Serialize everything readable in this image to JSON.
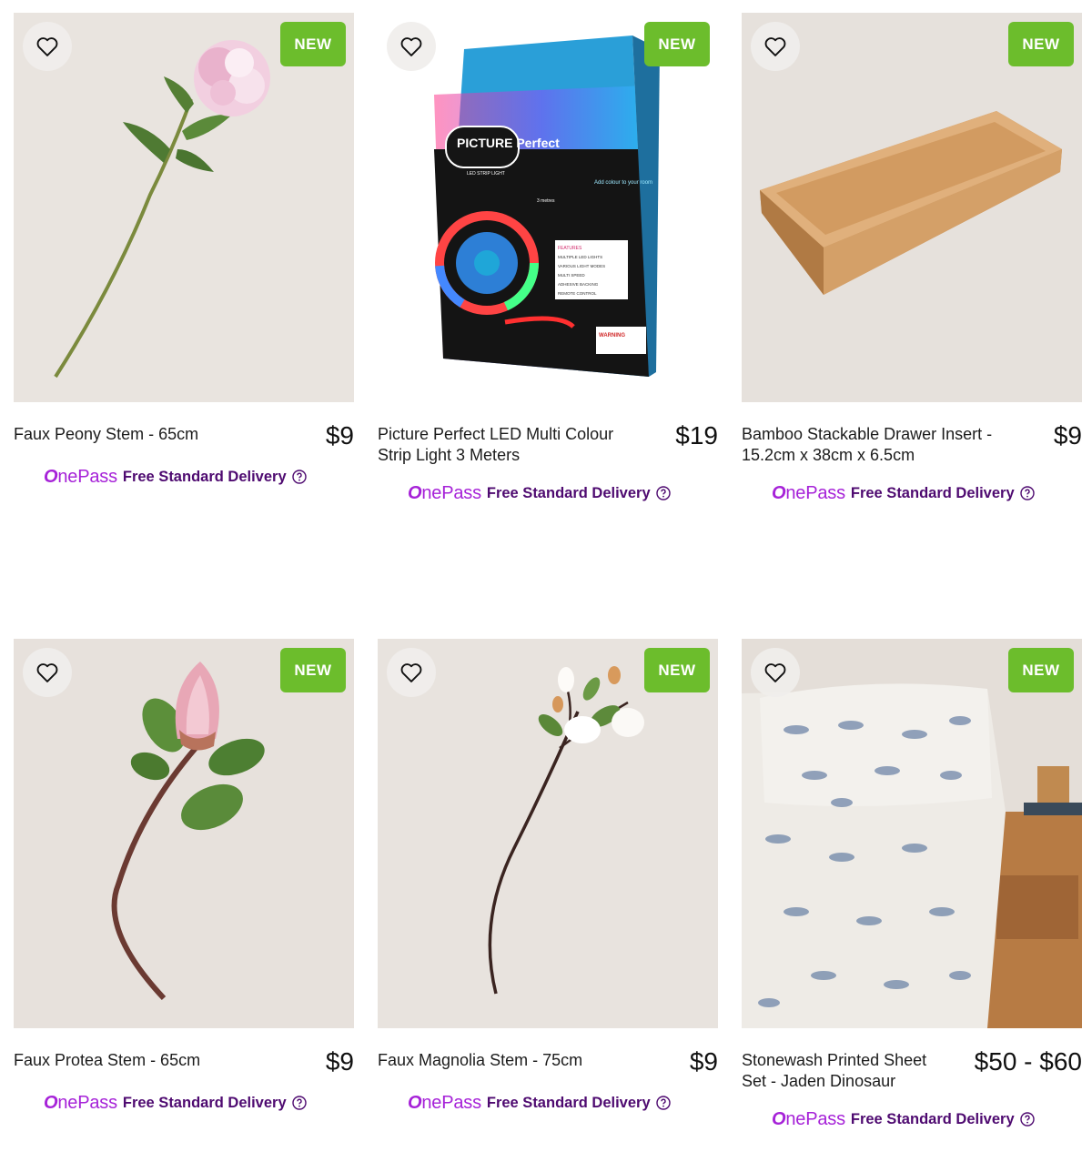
{
  "products": [
    {
      "name": "Faux Peony Stem - 65cm",
      "price": "$9",
      "badge": "NEW",
      "image": "faux-peony-image"
    },
    {
      "name": "Picture Perfect LED Multi Colour Strip Light 3 Meters",
      "price": "$19",
      "badge": "NEW",
      "image": "led-strip-box-image",
      "box_text": {
        "brand": "PICTURE Perfect",
        "product": "LED STRIP LIGHT",
        "length": "3 metres",
        "tagline": "Add colour to your room",
        "warning": "WARNING",
        "features_title": "FEATURES",
        "features": [
          "MULTIPLE LED LIGHTS",
          "VARIOUS LIGHT MODES",
          "MULTI SPEED",
          "ADHESIVE BACKING",
          "REMOTE CONTROL"
        ]
      }
    },
    {
      "name": "Bamboo Stackable Drawer Insert - 15.2cm x 38cm x 6.5cm",
      "price": "$9",
      "badge": "NEW",
      "image": "bamboo-tray-image"
    },
    {
      "name": "Faux Protea Stem - 65cm",
      "price": "$9",
      "badge": "NEW",
      "image": "faux-protea-image"
    },
    {
      "name": "Faux Magnolia Stem - 75cm",
      "price": "$9",
      "badge": "NEW",
      "image": "faux-magnolia-image"
    },
    {
      "name": "Stonewash Printed Sheet Set - Jaden Dinosaur",
      "price": "$50 - $60",
      "badge": "NEW",
      "image": "dinosaur-sheet-set-image"
    }
  ],
  "delivery": {
    "logo_o": "O",
    "logo_rest": "nePass",
    "text": "Free Standard Delivery"
  },
  "icons": {
    "wishlist": "heart-outline-icon",
    "help": "question-circle-icon"
  },
  "colors": {
    "badge": "#6cbd2c",
    "onepass_purple": "#a622d8",
    "delivery_text": "#4e0a70"
  }
}
